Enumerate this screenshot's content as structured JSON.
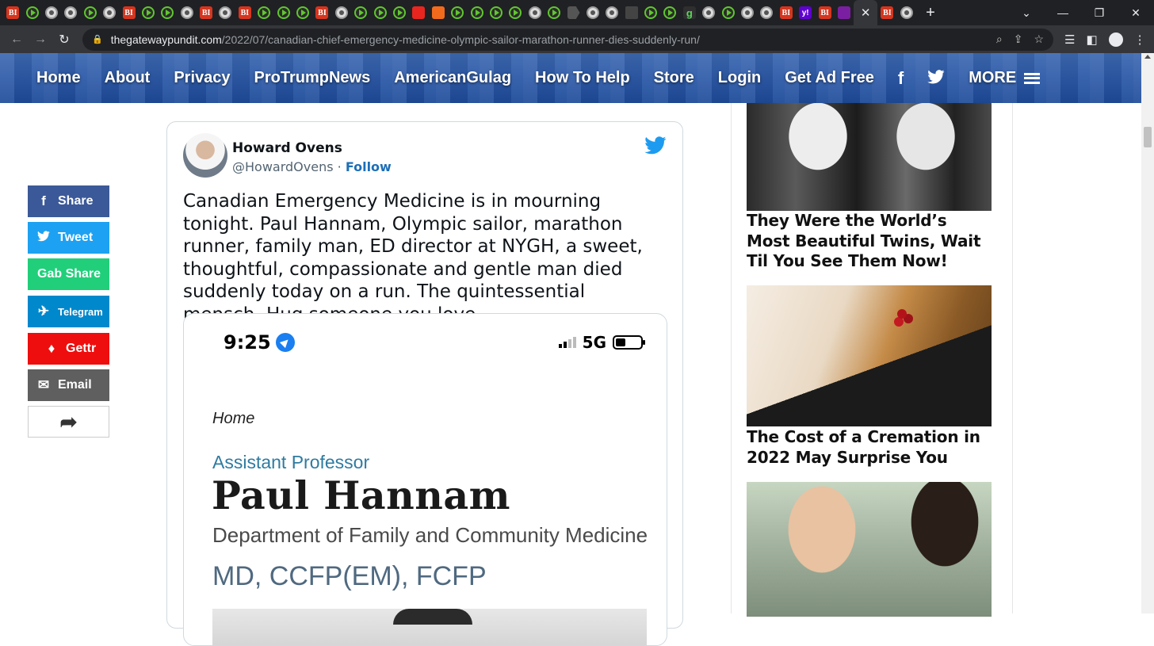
{
  "browser": {
    "active_tab_close": "✕",
    "new_tab": "+",
    "url_domain": "thegatewaypundit.com",
    "url_path": "/2022/07/canadian-chief-emergency-medicine-olympic-sailor-marathon-runner-dies-suddenly-run/",
    "tab_favicons": [
      "bi",
      "play",
      "globe",
      "globe",
      "play",
      "globe",
      "bi",
      "play",
      "play",
      "globe",
      "bi",
      "globe",
      "bi",
      "play",
      "play",
      "play",
      "bi",
      "globe",
      "play",
      "play",
      "play",
      "gettr",
      "sub",
      "play",
      "play",
      "play",
      "play",
      "globe",
      "play",
      "tri",
      "globe",
      "globe",
      "dark",
      "play",
      "play",
      "g",
      "globe",
      "play",
      "globe",
      "globe",
      "bi",
      "y",
      "bi",
      "mail"
    ]
  },
  "site_nav": {
    "links": [
      "Home",
      "About",
      "Privacy",
      "ProTrumpNews",
      "AmericanGulag",
      "How To Help",
      "Store",
      "Login",
      "Get Ad Free"
    ],
    "facebook": "f",
    "more": "MORE"
  },
  "share_buttons": [
    {
      "label": "Share",
      "icon": "f",
      "color": "#3b5998"
    },
    {
      "label": "Tweet",
      "icon": "🐦",
      "color": "#1da1f2"
    },
    {
      "label": "Gab Share",
      "icon": "",
      "color": "#21cf7a"
    },
    {
      "label": "Telegram",
      "icon": "✈",
      "color": "#0088cc"
    },
    {
      "label": "Gettr",
      "icon": "♦",
      "color": "#ef0e0e"
    },
    {
      "label": "Email",
      "icon": "✉",
      "color": "#5f5f5f"
    },
    {
      "label": "",
      "icon": "➦",
      "color": "#ffffff"
    }
  ],
  "tweet": {
    "name": "Howard Ovens",
    "handle": "@HowardOvens",
    "separator": " · ",
    "follow": "Follow",
    "text": "Canadian Emergency Medicine is in mourning tonight. Paul Hannam, Olympic sailor, marathon runner, family man, ED director at NYGH, a sweet, thoughtful, compassionate and gentle man died suddenly today on a run. The quintessential mensch. Hug someone you love.",
    "media": {
      "time": "9:25",
      "network": "5G",
      "home": "Home",
      "role": "Assistant Professor",
      "name": "Paul Hannam",
      "department": "Department of Family and Community Medicine",
      "credentials": "MD, CCFP(EM), FCFP"
    }
  },
  "sidebar_ads": [
    {
      "title": "They Were the World’s Most Beautiful Twins, Wait Til You See Them Now!"
    },
    {
      "title": "The Cost of a Cremation in 2022 May Surprise You"
    }
  ]
}
